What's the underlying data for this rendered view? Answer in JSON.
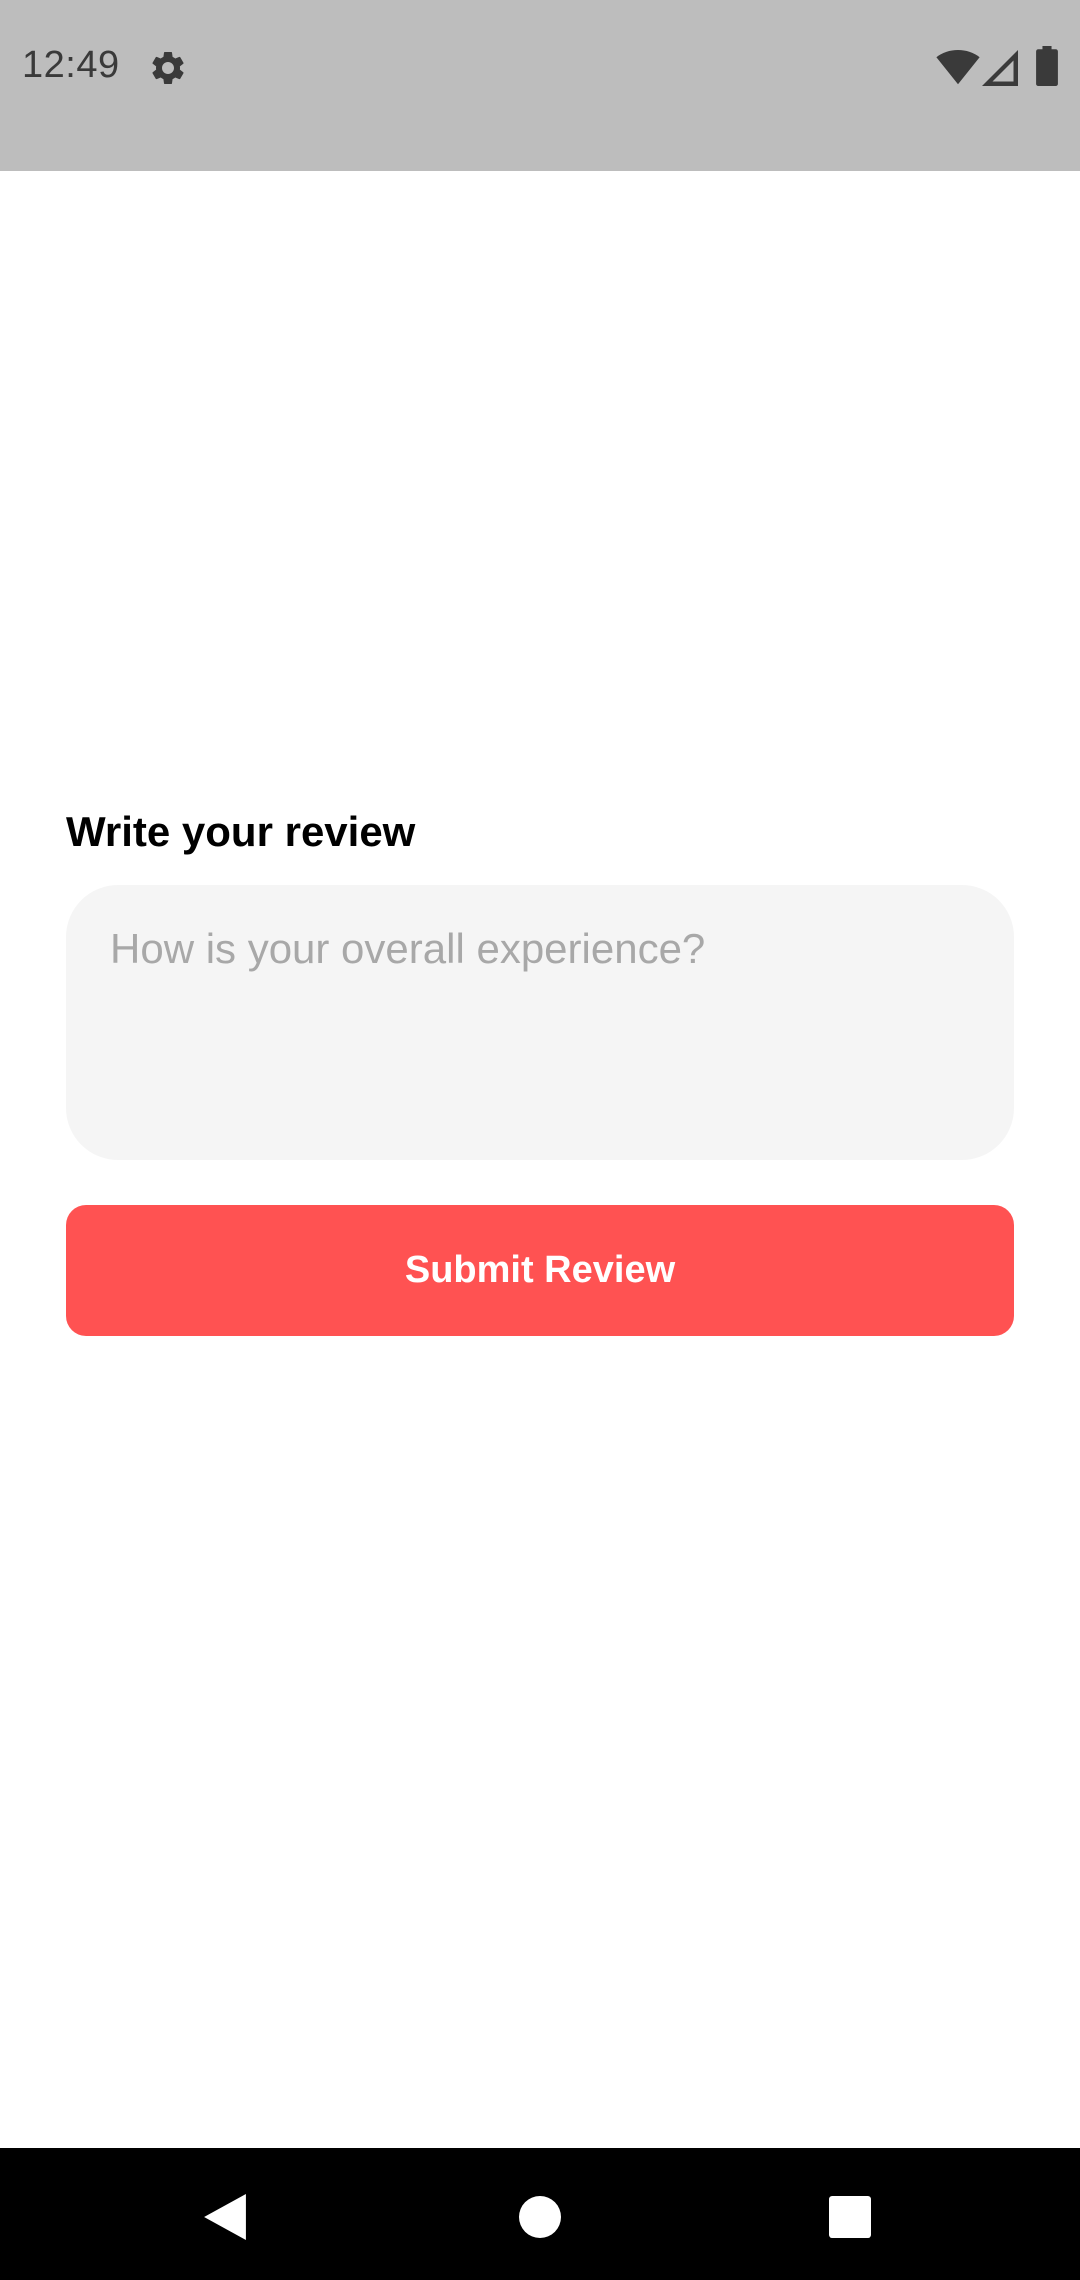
{
  "status_bar": {
    "time": "12:49",
    "icons": [
      "gear-icon",
      "wifi-icon",
      "cellular-signal-icon",
      "battery-icon"
    ]
  },
  "review": {
    "heading": "Write your review",
    "input_value": "",
    "input_placeholder": "How is your overall experience?",
    "submit_label": "Submit Review"
  },
  "nav_bar": {
    "icons": [
      "back-icon",
      "home-icon",
      "recents-icon"
    ]
  },
  "colors": {
    "status_bar_bg": "#bdbdbd",
    "accent": "#ff5252",
    "input_bg": "#f5f5f5",
    "nav_bar_bg": "#000000"
  }
}
